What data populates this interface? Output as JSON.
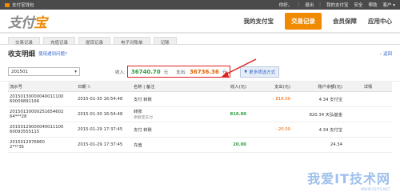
{
  "topbar": {
    "title": "支付宝钱包",
    "greeting": "你好，",
    "logout": "退出",
    "mine": "我的支付宝",
    "security": "安全",
    "help": "帮助",
    "more": "客户 ▾"
  },
  "header": {
    "logo_a": "支付",
    "logo_b": "宝",
    "nav": [
      "我的支付宝",
      "交易记录",
      "会员保障",
      "应用中心"
    ],
    "active_index": 1
  },
  "subnav": [
    "交易记录",
    "充值记录",
    "提现记录",
    "电子对账单",
    "记账"
  ],
  "page": {
    "title": "收支明细",
    "help_link": "使用遇到问题?",
    "back": "返回"
  },
  "filter": {
    "period": "201501",
    "income_label": "收入:",
    "income": "36740.70",
    "income_unit": "元",
    "expense_label": "支出:",
    "expense": "36736.36",
    "expense_unit": "元",
    "more_btn": "更多筛选方式"
  },
  "table": {
    "headers": [
      "流水号",
      "日期",
      "名称 | 备注",
      "收入(元)",
      "支出(元)",
      "账户余额(元)",
      "详情"
    ],
    "rows": [
      {
        "serial_a": "20150130000040011100",
        "serial_b": "60009891166",
        "date": "2015-01-30 16:54:48",
        "name": "支付 转账",
        "note": "",
        "income": "",
        "expense": "- 816.00",
        "balance": "4.34",
        "account": "支付宝",
        "detail": ""
      },
      {
        "serial_a": "20150130000251654602",
        "serial_b": "64***28",
        "date": "2015-01-30 16:54:48",
        "name": "转账",
        "note": "余额宝支付",
        "income": "816.00",
        "expense": "",
        "balance": "820.34",
        "account": "天弘基金",
        "detail": ""
      },
      {
        "serial_a": "20150129000040011100",
        "serial_b": "60093555115",
        "date": "2015-01-29 17:37:45",
        "name": "支付 转账",
        "note": "",
        "income": "",
        "expense": "- 20.00",
        "balance": "4.34",
        "account": "支付宝",
        "detail": ""
      },
      {
        "serial_a": "2015012976860",
        "serial_b": "2***35",
        "date": "2015-01-29 17:37:45",
        "name": "充值",
        "note": "",
        "income": "20.00",
        "expense": "",
        "balance": "24.34",
        "account": "",
        "detail": ""
      }
    ]
  },
  "watermark": {
    "text": "我爱IT技术网",
    "sub": "WWW.52ITS.NET"
  },
  "colors": {
    "accent": "#f08a00",
    "income": "#2a9a3a",
    "expense": "#e06000",
    "highlight_box": "#dd2222"
  }
}
